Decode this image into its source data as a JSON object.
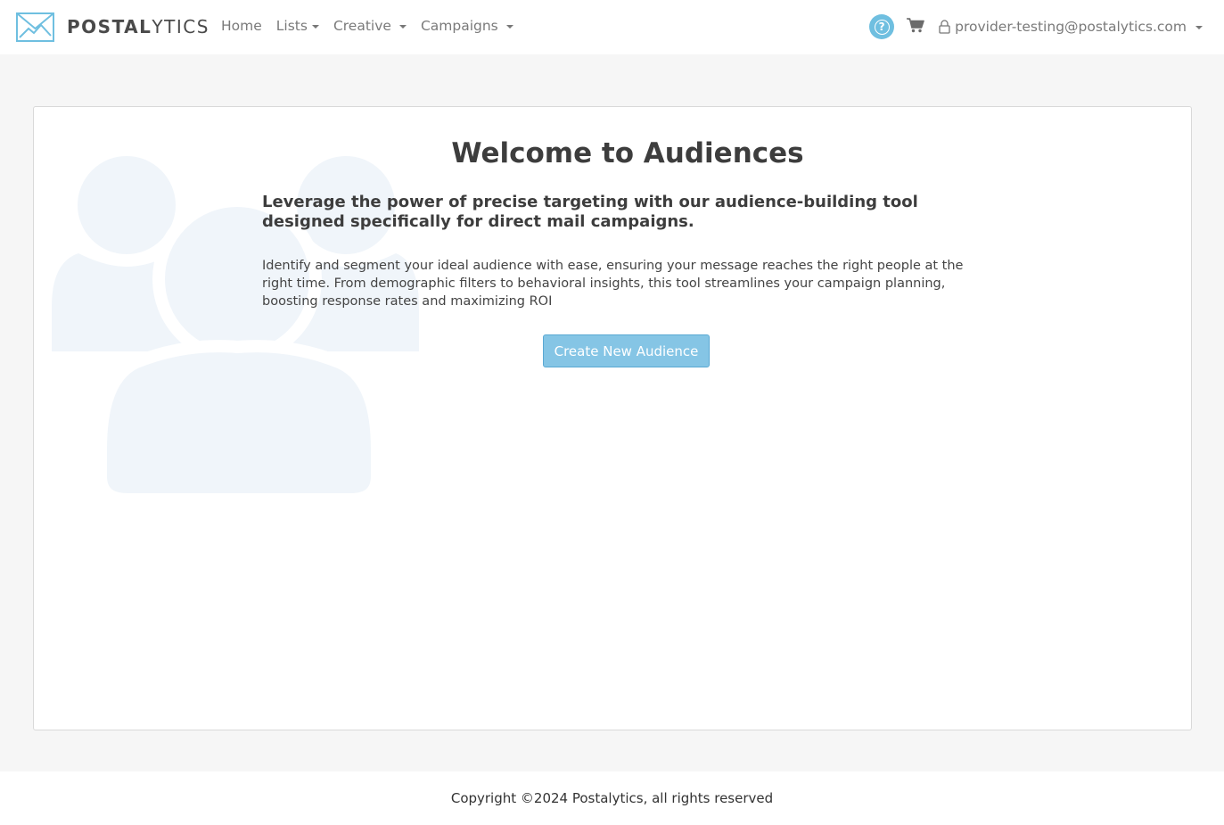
{
  "brand": {
    "name_bold": "POSTAL",
    "name_light": "YTICS",
    "logo_icon": "envelope-chart-icon",
    "logo_color": "#6fbfe0"
  },
  "nav": {
    "items": [
      {
        "label": "Home",
        "dropdown": false
      },
      {
        "label": "Lists",
        "dropdown": true
      },
      {
        "label": "Creative",
        "dropdown": true
      },
      {
        "label": "Campaigns",
        "dropdown": true
      }
    ],
    "help_icon": "question-circle-icon",
    "cart_icon": "shopping-cart-icon",
    "user_icon": "lock-icon",
    "user_email": "provider-testing@postalytics.com"
  },
  "main": {
    "title": "Welcome to Audiences",
    "subtitle": "Leverage the power of precise targeting with our audience-building tool designed specifically for direct mail campaigns.",
    "description": "Identify and segment your ideal audience with ease, ensuring your message reaches the right people at the right time. From demographic filters to behavioral insights, this tool streamlines your campaign planning, boosting response rates and maximizing ROI",
    "cta_label": "Create New Audience",
    "background_icon": "users-group-icon"
  },
  "footer": {
    "copyright": "Copyright ©2024 Postalytics, all rights reserved"
  },
  "colors": {
    "accent": "#6fbfe0",
    "button": "#85c5e5",
    "watermark": "#f0f5fa"
  }
}
